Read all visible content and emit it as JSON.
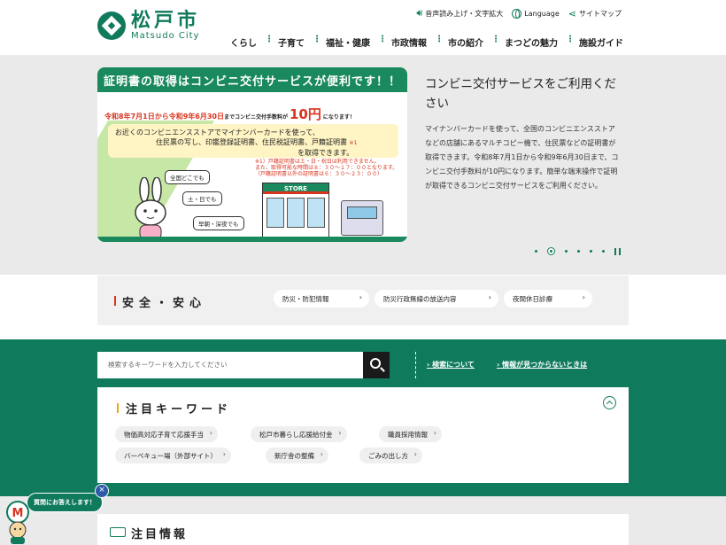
{
  "header": {
    "logo_jp": "松戸市",
    "logo_en": "Matsudo City",
    "utility": [
      {
        "icon": "speaker-icon",
        "label": "音声読み上げ・文字拡大"
      },
      {
        "icon": "globe-icon",
        "label": "Language"
      },
      {
        "icon": "share-icon",
        "label": "サイトマップ"
      }
    ],
    "nav": [
      "くらし",
      "子育て",
      "福祉・健康",
      "市政情報",
      "市の紹介",
      "まつどの魅力",
      "施設ガイド"
    ]
  },
  "hero": {
    "banner_title": "証明書の取得はコンビニ交付サービスが便利です！！",
    "banner_date": "令和8年7月1日から令和9年6月30日",
    "banner_fee_pre": "までコンビニ交付手数料が",
    "banner_fee": "10円",
    "banner_fee_post": "になります！",
    "banner_box_line1": "お近くのコンビニエンスストアでマイナンバーカードを使って、",
    "banner_box_line2": "住民票の写し、印鑑登録証明書、住民税証明書、戸籍証明書",
    "banner_box_note_mark": "※1",
    "banner_box_line3": "を取得できます。",
    "banner_note": "※1）戸籍証明書は土・日・祝日は利用できません。\nまた、取得可能な時間は８：３０～１７：００となります。\n（戸籍証明書以外の証明書は６：３０～２３：００）",
    "bubbles": [
      "全国どこでも",
      "土・日でも",
      "早朝・深夜でも"
    ],
    "store_label": "STORE",
    "title": "コンビニ交付サービスをご利用ください",
    "body": "マイナンバーカードを使って、全国のコンビニエンスストアなどの店舗にあるマルチコピー機で、住民票などの証明書が取得できます。令和8年7月1日から令和9年6月30日まで、コンビニ交付手数料が10円になります。簡単な端末操作で証明が取得できるコンビニ交付サービスをご利用ください。",
    "slide_count": 6,
    "active_slide": 2
  },
  "safety": {
    "title": "安全・安心",
    "links": [
      "防災・防犯情報",
      "防災行政無線の放送内容",
      "夜間休日診療"
    ]
  },
  "search": {
    "placeholder": "検索するキーワードを入力してください",
    "links": [
      "検索について",
      "情報が見つからないときは"
    ]
  },
  "keywords": {
    "title": "注目キーワード",
    "items": [
      "物価高対応子育て応援手当",
      "松戸市暮らし応援給付金",
      "職員採用情報",
      "バーベキュー場（外部サイト）",
      "新庁舎の整備",
      "ごみの出し方"
    ]
  },
  "notice": {
    "title": "注目情報"
  },
  "chat": {
    "label": "質問にお答えします！",
    "close": "×"
  },
  "colors": {
    "brand_green": "#107a5c",
    "banner_green": "#1a8a5e",
    "accent_red": "#d9341e",
    "accent_yellow": "#e5a81a"
  }
}
